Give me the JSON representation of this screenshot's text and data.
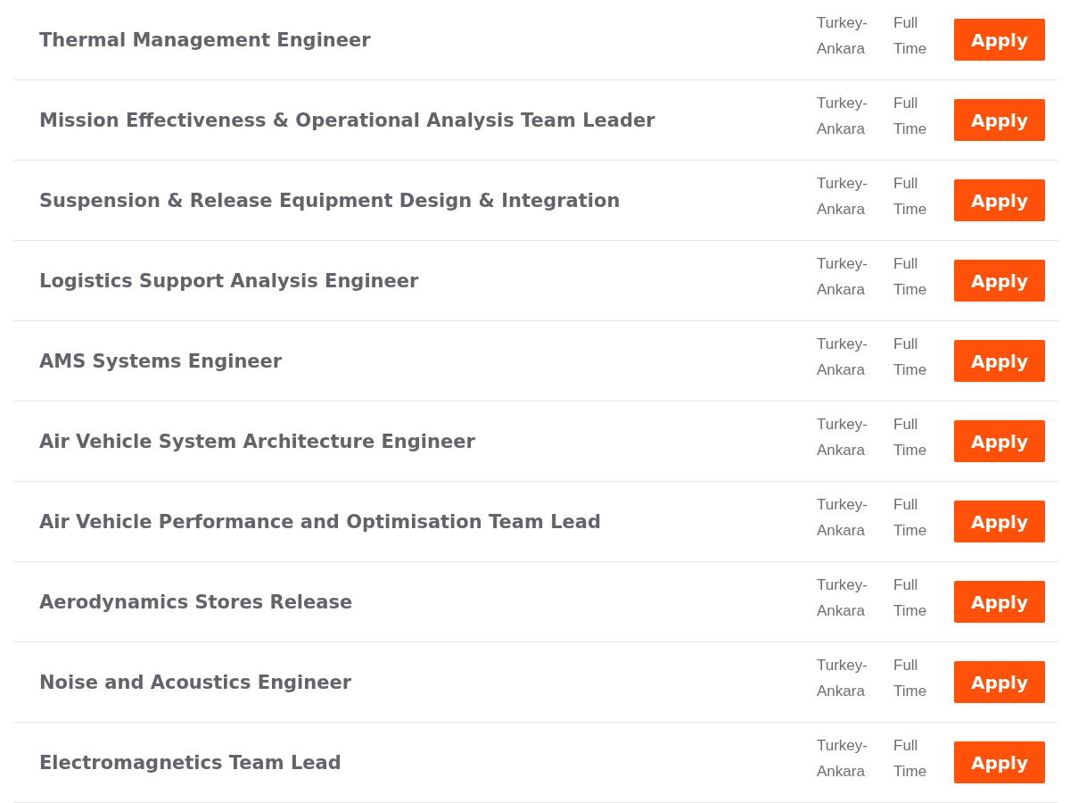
{
  "jobs": [
    {
      "title": "Thermal Management Engineer",
      "location": "Turkey-Ankara",
      "type": "Full Time",
      "button": "Apply"
    },
    {
      "title": "Mission Effectiveness & Operational Analysis Team Leader",
      "location": "Turkey-Ankara",
      "type": "Full Time",
      "button": "Apply"
    },
    {
      "title": "Suspension & Release Equipment Design & Integration",
      "location": "Turkey-Ankara",
      "type": "Full Time",
      "button": "Apply"
    },
    {
      "title": "Logistics Support Analysis Engineer",
      "location": "Turkey-Ankara",
      "type": "Full Time",
      "button": "Apply"
    },
    {
      "title": "AMS Systems Engineer",
      "location": "Turkey-Ankara",
      "type": "Full Time",
      "button": "Apply"
    },
    {
      "title": "Air Vehicle System Architecture Engineer",
      "location": "Turkey-Ankara",
      "type": "Full Time",
      "button": "Apply"
    },
    {
      "title": "Air Vehicle Performance and Optimisation Team Lead",
      "location": "Turkey-Ankara",
      "type": "Full Time",
      "button": "Apply"
    },
    {
      "title": "Aerodynamics Stores Release",
      "location": "Turkey-Ankara",
      "type": "Full Time",
      "button": "Apply"
    },
    {
      "title": "Noise and Acoustics Engineer",
      "location": "Turkey-Ankara",
      "type": "Full Time",
      "button": "Apply"
    },
    {
      "title": "Electromagnetics Team Lead",
      "location": "Turkey-Ankara",
      "type": "Full Time",
      "button": "Apply"
    }
  ]
}
